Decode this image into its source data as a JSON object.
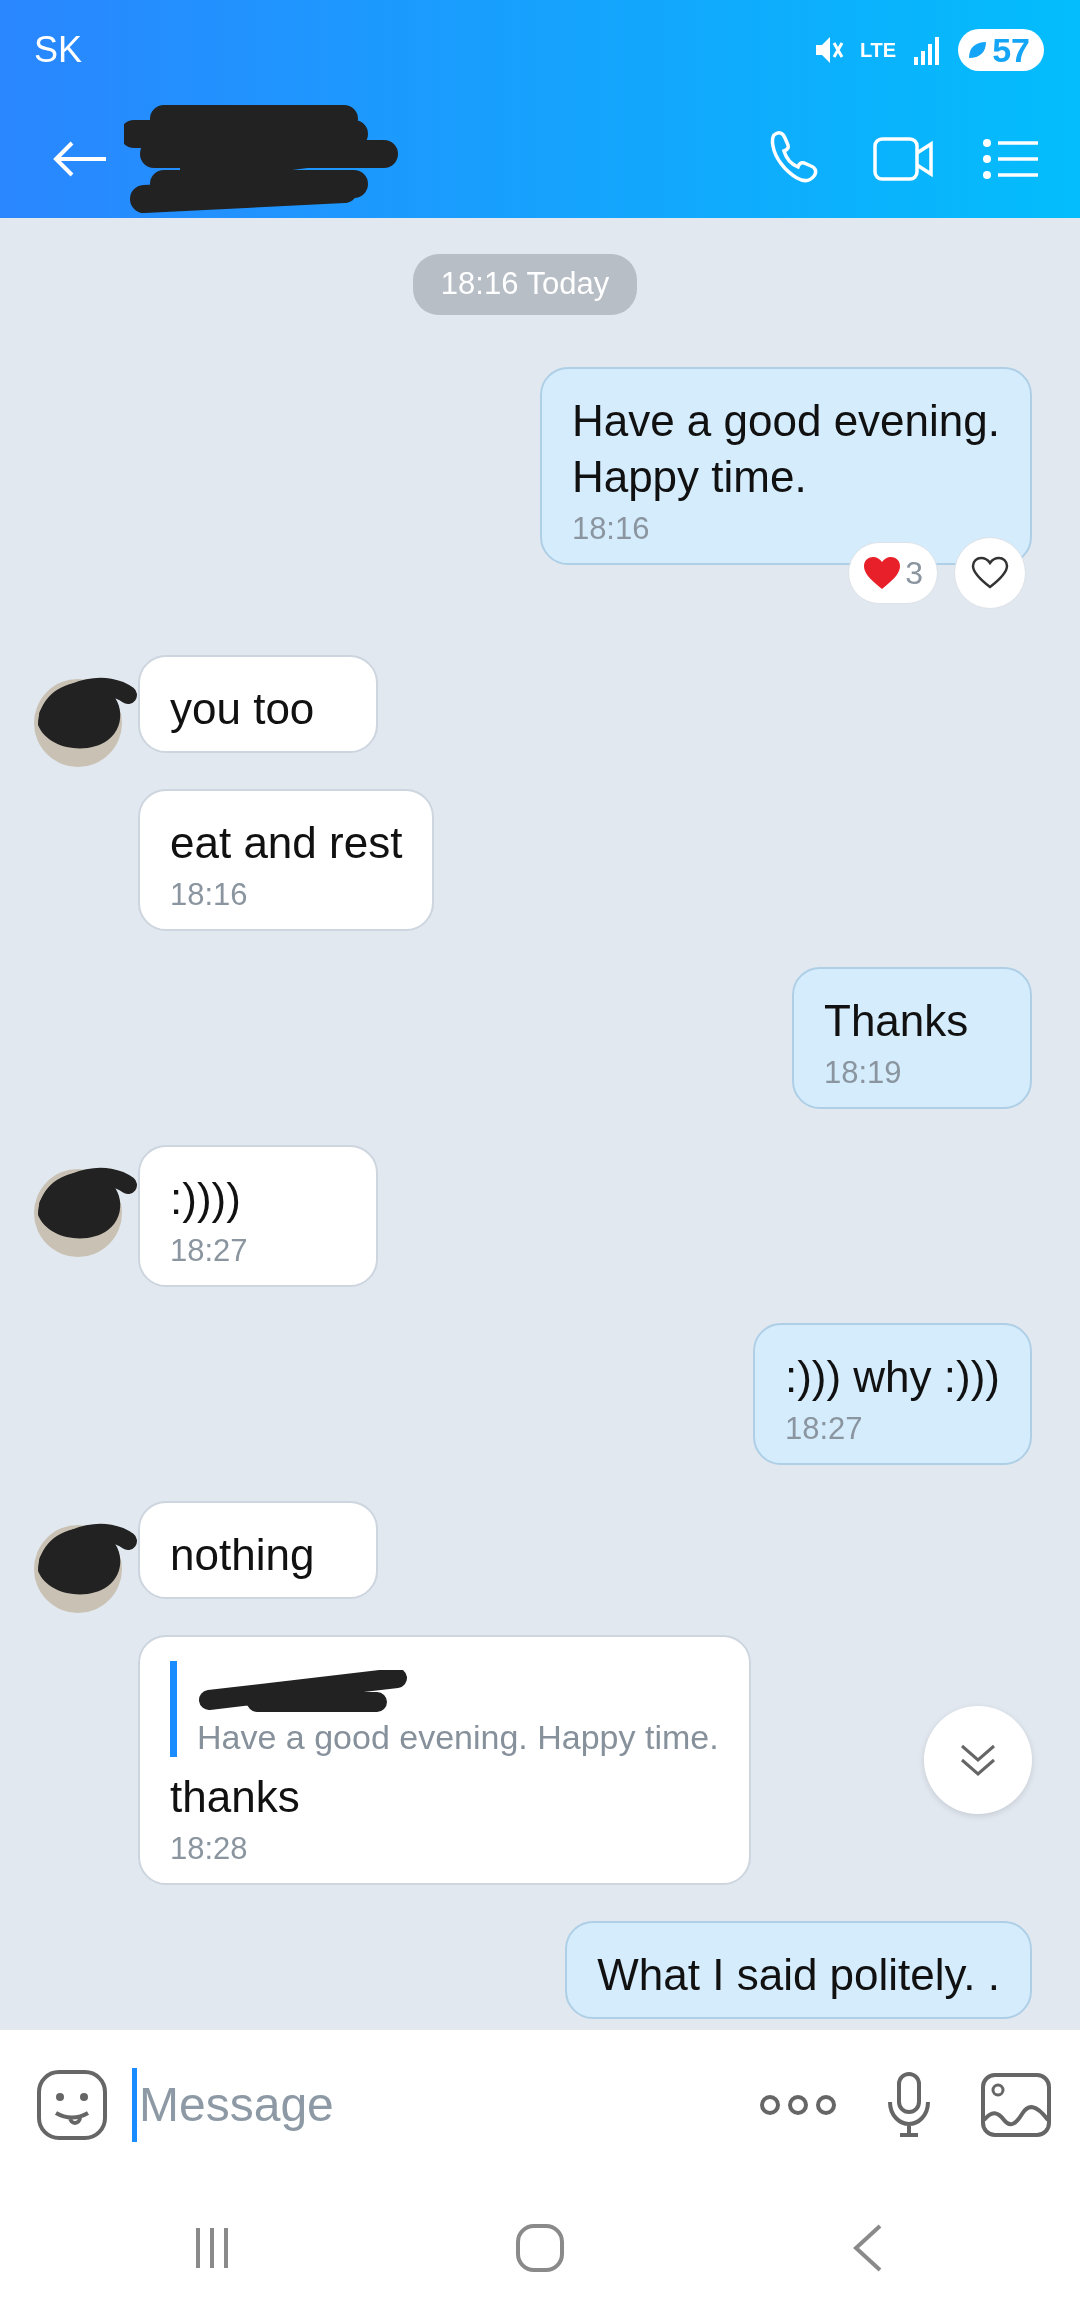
{
  "status_bar": {
    "carrier": "SK",
    "network": "LTE",
    "battery": "57"
  },
  "date_divider": "18:16 Today",
  "messages": [
    {
      "kind": "outgoing",
      "text": "Have a good evening.\nHappy time.",
      "time": "18:16",
      "reactions": {
        "count": "3",
        "liked": false
      }
    },
    {
      "kind": "incoming",
      "avatar": true,
      "text": "you too"
    },
    {
      "kind": "incoming",
      "avatar": false,
      "text": "eat and rest",
      "time": "18:16"
    },
    {
      "kind": "outgoing",
      "text": "Thanks",
      "time": "18:19"
    },
    {
      "kind": "incoming",
      "avatar": true,
      "text": ":))))",
      "time": "18:27"
    },
    {
      "kind": "outgoing",
      "text": ":))) why :)))",
      "time": "18:27"
    },
    {
      "kind": "incoming",
      "avatar": true,
      "text": "nothing"
    },
    {
      "kind": "incoming",
      "avatar": false,
      "quote": "Have a good evening.  Happy time.",
      "text": "thanks",
      "time": "18:28"
    },
    {
      "kind": "outgoing",
      "text": "What I said politely. ."
    }
  ],
  "composer": {
    "placeholder": "Message"
  }
}
